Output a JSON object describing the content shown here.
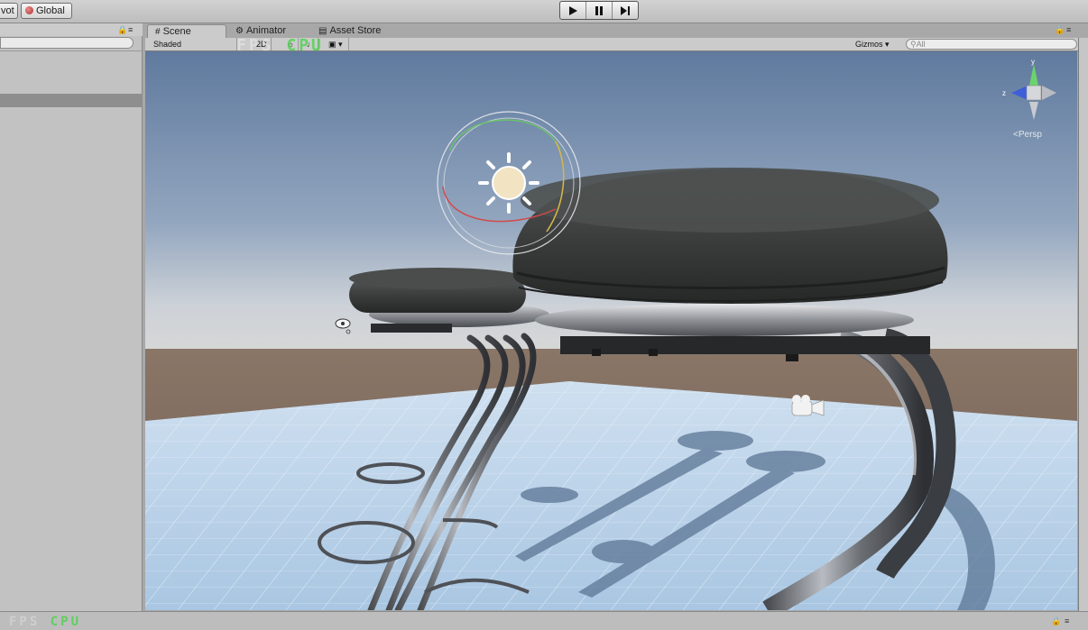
{
  "toolbar": {
    "pivot_label": "vot",
    "global_label": "Global",
    "play_icon": "play-icon",
    "pause_icon": "pause-icon",
    "step_icon": "step-icon"
  },
  "tabs": [
    {
      "label": "Scene",
      "icon": "grid-icon"
    },
    {
      "label": "Animator",
      "icon": "animator-icon"
    },
    {
      "label": "Asset Store",
      "icon": "store-icon"
    }
  ],
  "scene_toolbar": {
    "draw_mode": "Shaded",
    "mode_2d": "2D",
    "gizmos_label": "Gizmos",
    "search_placeholder": "All"
  },
  "view_gizmo": {
    "y_label": "y",
    "z_label": "z",
    "projection_label": "Persp"
  },
  "watermark": {
    "top_text": "FPS",
    "top_accent": "CPU",
    "bottom_text": "FPS",
    "bottom_accent": "CPU"
  },
  "colors": {
    "sky_top": "#6e86a6",
    "horizon": "#c8ccd2",
    "ground": "#7a675a",
    "floor": "#bcd4ea",
    "seat": "#3a3c3a",
    "chrome": "#8a8c90",
    "watermark_green": "#3ad63a"
  }
}
